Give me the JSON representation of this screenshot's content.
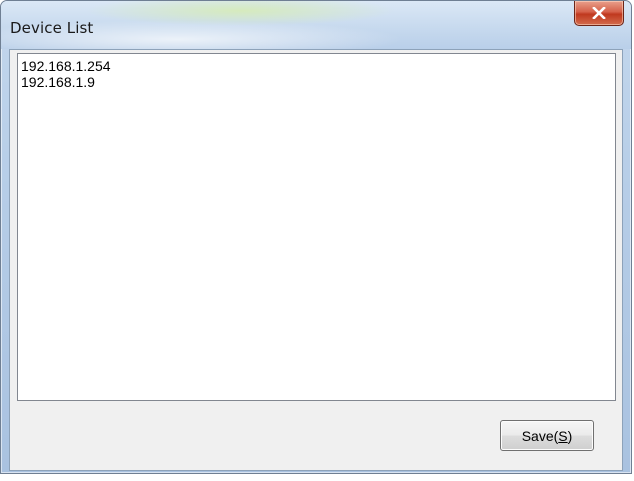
{
  "window": {
    "title": "Device List",
    "close_label": "x"
  },
  "device_list": {
    "items": [
      "192.168.1.254",
      "192.168.1.9"
    ]
  },
  "footer": {
    "save_label_prefix": "Save(",
    "save_mnemonic": "S",
    "save_label_suffix": ")"
  },
  "colors": {
    "close_button": "#c0391f",
    "titlebar": "#c9dbef",
    "client_bg": "#f0f0f0"
  }
}
